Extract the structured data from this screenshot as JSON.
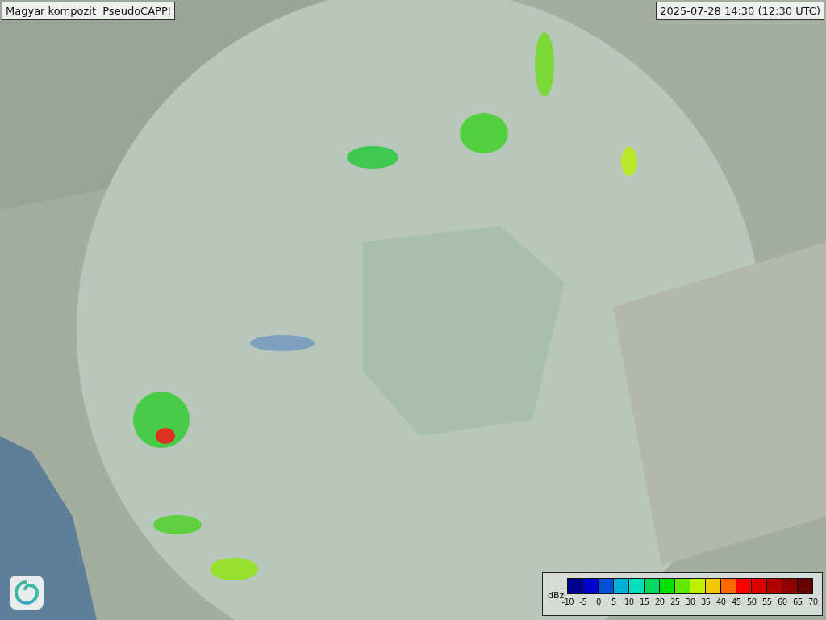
{
  "title": "Magyar kompozit  PseudoCAPPI",
  "timestamp": "2025-07-28 14:30 (12:30 UTC)",
  "legend": {
    "unit": "dBz",
    "bins": [
      {
        "color": "#000090"
      },
      {
        "color": "#0000d0"
      },
      {
        "color": "#0050d8"
      },
      {
        "color": "#00b0d8"
      },
      {
        "color": "#00e0b8"
      },
      {
        "color": "#00d860"
      },
      {
        "color": "#00e000"
      },
      {
        "color": "#60e800"
      },
      {
        "color": "#c0f000"
      },
      {
        "color": "#f0c800"
      },
      {
        "color": "#ff6800"
      },
      {
        "color": "#ff0000"
      },
      {
        "color": "#d80000"
      },
      {
        "color": "#b00000"
      },
      {
        "color": "#900000"
      },
      {
        "color": "#680000"
      }
    ],
    "ticks": [
      "-10",
      "-5",
      "0",
      "5",
      "10",
      "15",
      "20",
      "25",
      "30",
      "35",
      "40",
      "45",
      "50",
      "55",
      "60",
      "65",
      "70"
    ]
  }
}
